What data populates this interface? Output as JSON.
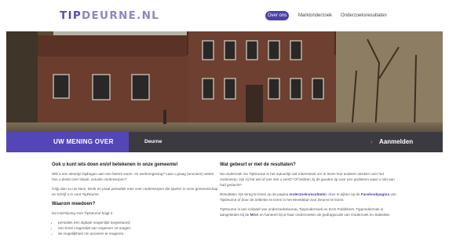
{
  "header": {
    "logo_part1": "TIP",
    "logo_part2": "DEURNE.NL",
    "nav": [
      "Over ons",
      "Marktonderzoek",
      "Onderzoeksresultaten"
    ]
  },
  "banner": {
    "title": "UW MENING OVER",
    "subtitle": "Deurne",
    "cta_arrow": "›",
    "cta": "Aanmelden"
  },
  "left": {
    "heading": "Ook u kunt iets doen en/of betekenen in onze gemeente!",
    "p1": "Wilt u een steentje bijdragen aan een betere woon- en werkomgeving? Laat u graag (anoniem) weten hoe u denkt over lokale, actuele onderwerpen?",
    "p2": "Grijp dan nu uw kans. Denk en praat periodiek mee over onderwerpen die spelen in onze gemeenschap en schrijf u in voor TipDeurne.",
    "heading2": "Waarom meedoen?",
    "p3": "Na inschrijving voor TipDeurne krijgt u:",
    "list": [
      "periodiek een digitale vragenlijst toegestuurd;",
      "een korte vragenlijst van ongeveer 10 vragen;",
      "de mogelijkheid om anoniem te reageren."
    ]
  },
  "right": {
    "heading": "Wat gebeurt er met de resultaten?",
    "p1": "Na onderzoek via TipDeurne is het natuurlijk ook interessant om te lezen hoe anderen denken over het onderwerp; zijn zij het wel of niet met u eens? Of hebben zij de gouden tip voor een probleem waar u niet aan had gedacht?",
    "p2_a": "Resultaten zijn terug te lezen op de pagina ",
    "p2_link1": "onderzoeksresultaten",
    "p2_b": ", door te kijken op de ",
    "p2_link2": "Facebookpagina",
    "p2_c": " van TipDeurne of door de artikelen te lezen in het Weekblad voor Deurne te lezen.",
    "p3_a": "TipDeurne is een initiatief van onderzoeksbureau Tipponderzoek en DAS Publishers. Tipponderzoek is aangesloten bij de ",
    "p3_link": "MOA",
    "p3_b": " en hanteert bij al haar onderzoeken de gedragscode van Onderzoek en Statistiek."
  }
}
